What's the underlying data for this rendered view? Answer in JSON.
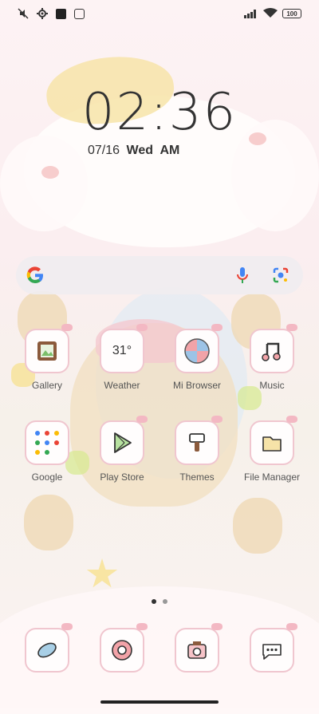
{
  "status_bar": {
    "battery_level": "100",
    "left_icons": [
      "mute-icon",
      "settings-icon",
      "square-notification-icon",
      "mi-icon"
    ],
    "right_icons": [
      "signal-icon",
      "wifi-icon",
      "battery-icon"
    ]
  },
  "clock": {
    "time": "02:36",
    "date": "07/16",
    "weekday": "Wed",
    "ampm": "AM"
  },
  "search_bar": {
    "left_icon": "google-logo-icon",
    "right_icons": [
      "microphone-icon",
      "google-lens-icon"
    ]
  },
  "apps": [
    {
      "label": "Gallery",
      "icon": "gallery-icon"
    },
    {
      "label": "Weather",
      "icon": "weather-icon",
      "icon_text": "31°"
    },
    {
      "label": "Mi Browser",
      "icon": "browser-icon"
    },
    {
      "label": "Music",
      "icon": "music-icon"
    },
    {
      "label": "Google",
      "icon": "google-folder-icon"
    },
    {
      "label": "Play Store",
      "icon": "play-store-icon"
    },
    {
      "label": "Themes",
      "icon": "themes-icon"
    },
    {
      "label": "File Manager",
      "icon": "folder-icon"
    }
  ],
  "dock": [
    {
      "icon": "phone-icon"
    },
    {
      "icon": "chrome-icon"
    },
    {
      "icon": "camera-icon"
    },
    {
      "icon": "messages-icon"
    }
  ],
  "pager": {
    "pages": 2,
    "active": 1
  }
}
